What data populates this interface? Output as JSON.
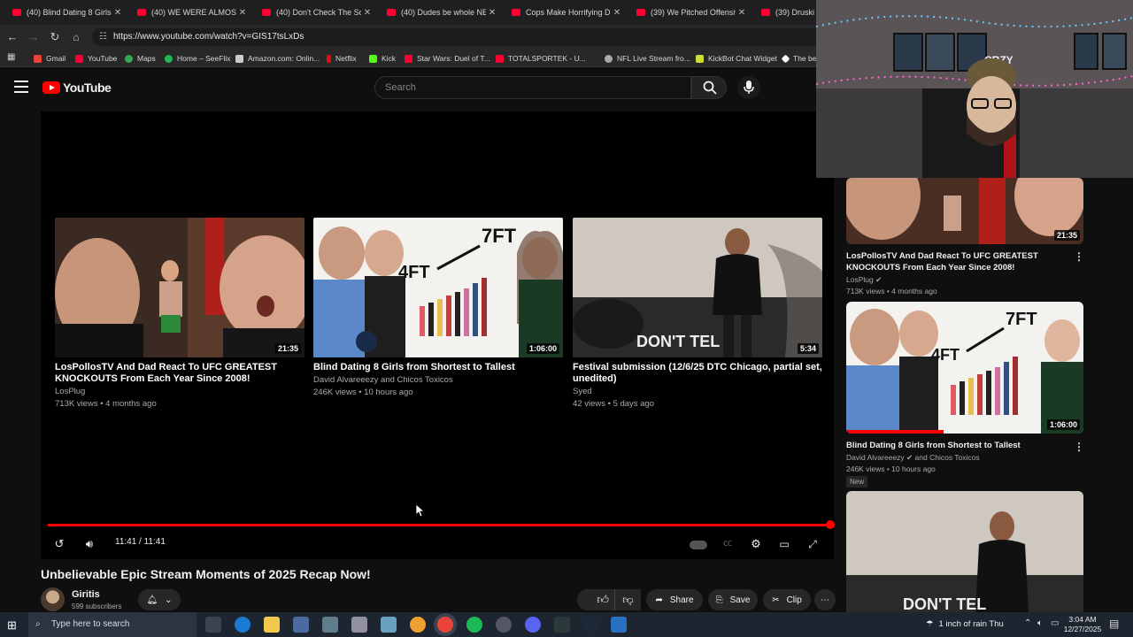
{
  "tabs": [
    {
      "title": "(40) Blind Dating 8 Girls fr"
    },
    {
      "title": "(40) WE WERE ALMOST IN"
    },
    {
      "title": "(40) Don't Check The Sou"
    },
    {
      "title": "(40) Dudes be whole NER"
    },
    {
      "title": "Cops Make Horrifying Dis"
    },
    {
      "title": "(39) We Pitched Offensive"
    },
    {
      "title": "(39) Druski &"
    }
  ],
  "address": {
    "url": "https://www.youtube.com/watch?v=GIS17tsLxDs"
  },
  "bookmarks": [
    {
      "label": "Gmail",
      "color": "#ea4335"
    },
    {
      "label": "YouTube",
      "color": "#ff0033"
    },
    {
      "label": "Maps",
      "color": "#34a853"
    },
    {
      "label": "Home – SeeFlix",
      "color": "#1db954"
    },
    {
      "label": "Amazon.com: Onlin...",
      "color": "#cccccc"
    },
    {
      "label": "Netflix",
      "color": "#e50914"
    },
    {
      "label": "Kick",
      "color": "#53fc18"
    },
    {
      "label": "Star Wars: Duel of T...",
      "color": "#ff0033"
    },
    {
      "label": "TOTALSPORTEK - U...",
      "color": "#ff0033"
    },
    {
      "label": "NFL Live Stream fro...",
      "color": "#aaaaaa"
    },
    {
      "label": "KickBot Chat Widget",
      "color": "#cddc39"
    },
    {
      "label": "The be",
      "color": "#ffffff"
    }
  ],
  "youtube": {
    "logo": "YouTube",
    "search_placeholder": "Search"
  },
  "player": {
    "endscreen": [
      {
        "title": "LosPollosTV And Dad React To UFC GREATEST KNOCKOUTS From Each Year Since 2008!",
        "channel": "LosPlug",
        "stats": "713K views • 4 months ago",
        "duration": "21:35"
      },
      {
        "title": "Blind Dating 8 Girls from Shortest to Tallest",
        "channel": "David Alvareeezy and Chicos Toxicos",
        "stats": "246K views • 10 hours ago",
        "duration": "1:06:00"
      },
      {
        "title": "Festival submission (12/6/25 DTC Chicago, partial set, unedited)",
        "channel": "Syed",
        "stats": "42 views • 5 days ago",
        "duration": "5:34"
      }
    ],
    "thumb_text": {
      "height_short": "4FT",
      "height_tall": "7FT",
      "sign": "DON'T TEL"
    },
    "time": "11:41 / 11:41",
    "progress": 1.0
  },
  "video": {
    "title": "Unbelievable Epic Stream Moments of 2025 Recap Now!",
    "channel": "Giritis",
    "subscribers": "599 subscribers",
    "likes": "8",
    "share": "Share",
    "save": "Save",
    "clip": "Clip"
  },
  "webcam": {
    "sign": "CRZY"
  },
  "sidebar": [
    {
      "title": "LosPollosTV And Dad React To UFC GREATEST KNOCKOUTS From Each Year Since 2008!",
      "channel": "LosPlug",
      "stats": "713K views • 4 months ago",
      "duration": "21:35"
    },
    {
      "title": "Blind Dating 8 Girls from Shortest to Tallest",
      "channel": "David Alvareeezy",
      "channel2": "and Chicos Toxicos",
      "stats": "246K views • 10 hours ago",
      "duration": "1:06:00",
      "badge": "New"
    },
    {
      "sign": "DON'T TEL"
    }
  ],
  "taskbar": {
    "search_placeholder": "Type here to search",
    "weather": "1 inch of rain Thu",
    "time": "3:04 AM",
    "date": "12/27/2025"
  }
}
